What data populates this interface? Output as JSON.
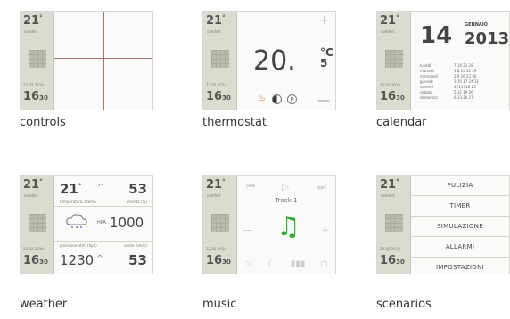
{
  "sidebar": {
    "temperature": "21",
    "temperature_unit": "°",
    "temperature_label": "comfort",
    "date": "22.02.2014",
    "time": "16",
    "time_small": "30"
  },
  "tiles": {
    "controls": {
      "caption": "controls"
    },
    "thermostat": {
      "caption": "thermostat",
      "plus": "+",
      "minus": "—",
      "value": "20.",
      "unit_c": "°C",
      "decimal": "5",
      "icons": [
        "heating-icon",
        "half-moon-icon",
        "p-icon"
      ]
    },
    "calendar": {
      "caption": "calendar",
      "day": "14",
      "month": "GENNAIO",
      "year": "2013",
      "weekdays": [
        "lunedì",
        "martedì",
        "mercoledì",
        "giovedì",
        "venerdì",
        "sabato",
        "domenica"
      ],
      "dates": [
        "7 14 21 28",
        "1 8 15 22 29",
        "2 9 16 23 30",
        "3 10 17 24 31",
        "4 (11) 18 25",
        "5 12 19 26",
        "6 13 20 27"
      ]
    },
    "weather": {
      "caption": "weather",
      "temp": "21",
      "temp_unit": "°",
      "humidity": "53",
      "temp_label": "temperatura interna",
      "humidity_label": "umidità (%)",
      "pressure_unit": "HPA",
      "pressure": "1000",
      "bottom_left_label": "pressione atm. (hpa)",
      "bottom_right_label": "vento (km/h)",
      "bottom_left": "1230",
      "bottom_right": "53"
    },
    "music": {
      "caption": "music",
      "track": "Track 1"
    },
    "scenarios": {
      "caption": "scenarios",
      "items": [
        "PULIZIA",
        "TIMER",
        "SIMULAZIONE",
        "ALLARMI",
        "IMPOSTAZIONI"
      ]
    }
  }
}
